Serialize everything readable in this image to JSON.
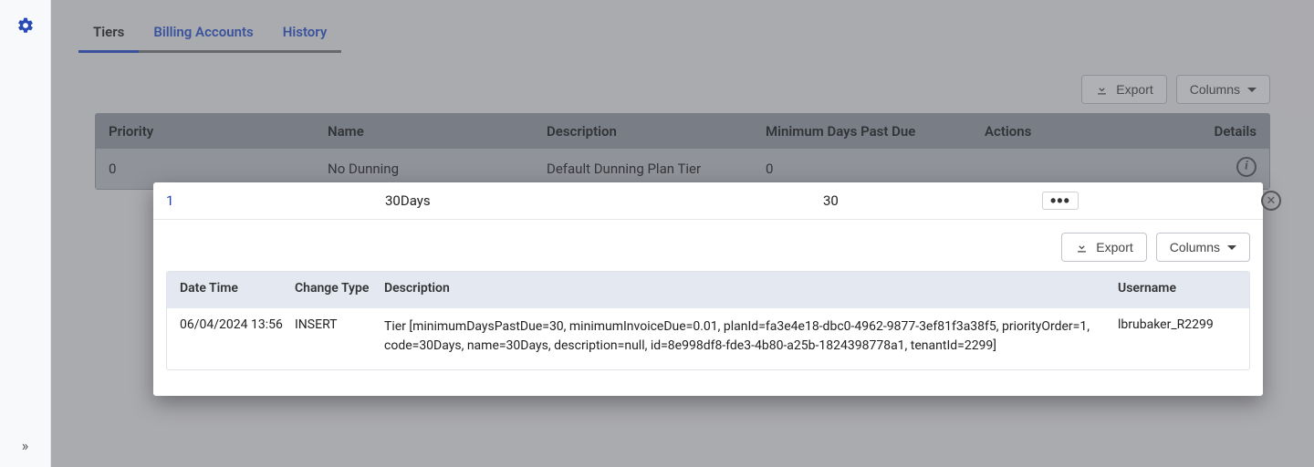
{
  "sidebar": {
    "gear": "gear",
    "expand": "»"
  },
  "tabs": [
    {
      "label": "Tiers",
      "active": true
    },
    {
      "label": "Billing Accounts",
      "active": false
    },
    {
      "label": "History",
      "active": false
    }
  ],
  "toolbar": {
    "export": "Export",
    "columns": "Columns"
  },
  "outerTable": {
    "headers": {
      "priority": "Priority",
      "name": "Name",
      "description": "Description",
      "minDays": "Minimum Days Past Due",
      "actions": "Actions",
      "details": "Details"
    },
    "rows": [
      {
        "priority": "0",
        "name": "No Dunning",
        "description": "Default Dunning Plan Tier",
        "minDays": "0"
      },
      {
        "priority": "1",
        "name": "30Days",
        "description": "",
        "minDays": "30"
      }
    ]
  },
  "panel": {
    "toolbar": {
      "export": "Export",
      "columns": "Columns"
    },
    "inner": {
      "headers": {
        "datetime": "Date Time",
        "changeType": "Change Type",
        "description": "Description",
        "username": "Username"
      },
      "row": {
        "datetime": "06/04/2024 13:56",
        "changeType": "INSERT",
        "description": "Tier [minimumDaysPastDue=30, minimumInvoiceDue=0.01, planId=fa3e4e18-dbc0-4962-9877-3ef81f3a38f5, priorityOrder=1, code=30Days, name=30Days, description=null, id=8e998df8-fde3-4b80-a25b-1824398778a1, tenantId=2299]",
        "username": "lbrubaker_R2299"
      }
    }
  }
}
